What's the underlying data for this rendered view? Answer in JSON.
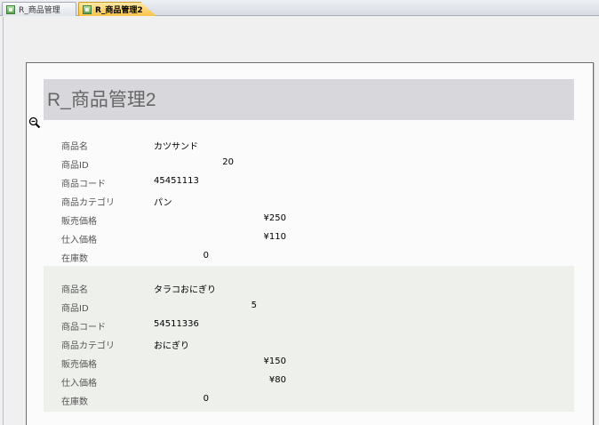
{
  "tabs": [
    {
      "label": "R_商品管理",
      "active": false
    },
    {
      "label": "R_商品管理2",
      "active": true
    }
  ],
  "report": {
    "title": "R_商品管理2",
    "labels": {
      "name": "商品名",
      "id": "商品ID",
      "code": "商品コード",
      "category": "商品カテゴリ",
      "price": "販売価格",
      "cost": "仕入価格",
      "stock": "在庫数"
    },
    "records": [
      {
        "name": "カツサンド",
        "id": "20",
        "code": "45451113",
        "category": "パン",
        "price": "¥250",
        "cost": "¥110",
        "stock": "0"
      },
      {
        "name": "タラコおにぎり",
        "id": "5",
        "code": "54511336",
        "category": "おにぎり",
        "price": "¥150",
        "cost": "¥80",
        "stock": "0"
      }
    ]
  },
  "colors": {
    "active_tab": "#f7c24a",
    "header_band": "#d8d8dc",
    "alt_row": "#eef0ec"
  },
  "icons": {
    "tab": "report-icon",
    "cursor": "zoom-cursor-icon"
  }
}
